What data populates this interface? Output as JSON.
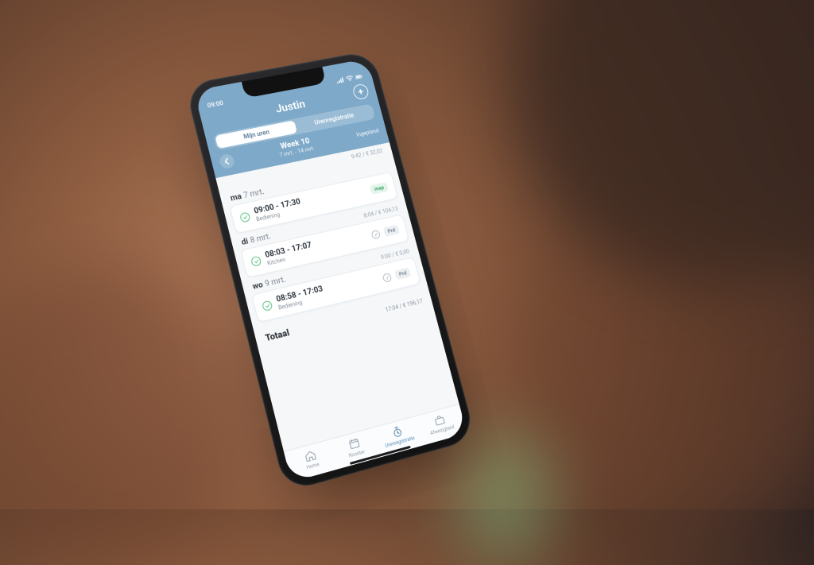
{
  "statusbar": {
    "time": "09:00"
  },
  "header": {
    "title": "Justin",
    "segments": {
      "left": "Mijn uren",
      "right": "Urenregistratie"
    },
    "week_label": "Week 10",
    "week_range": "7 mrt. - 14 mrt.",
    "status_right": "Ingepland",
    "header_totals": "9:42 / € 32,02"
  },
  "days": [
    {
      "dow": "ma",
      "date": "7 mrt.",
      "summary": "",
      "shift": {
        "time": "09:00 - 17:30",
        "role": "Bediening",
        "badge": "map",
        "badge_style": "map"
      }
    },
    {
      "dow": "di",
      "date": "8 mrt.",
      "summary": "8:04 / € 104,13",
      "shift": {
        "time": "08:03 - 17:07",
        "role": "Kitchen",
        "badge": "Prd",
        "badge_style": "prd"
      }
    },
    {
      "dow": "wo",
      "date": "9 mrt.",
      "summary": "9:00 / € 0,00",
      "shift": {
        "time": "08:58 - 17:03",
        "role": "Bediening",
        "badge": "Prd",
        "badge_style": "prd"
      }
    }
  ],
  "total": {
    "label": "Totaal",
    "value": "17:04 / € 196,17"
  },
  "tabs": {
    "home": "Home",
    "rooster": "Rooster",
    "uren": "Urenregistratie",
    "verz": "Afwezigheid"
  }
}
